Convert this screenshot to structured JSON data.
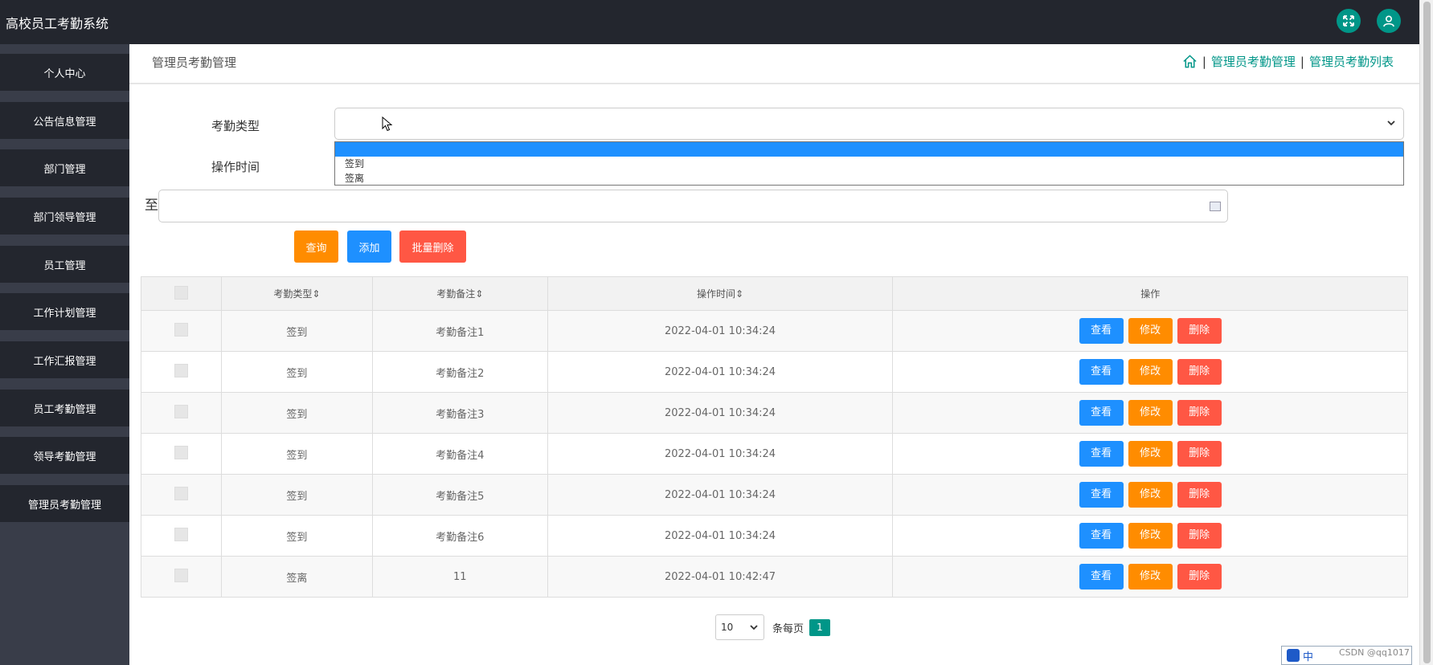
{
  "app": {
    "title": "高校员工考勤系统"
  },
  "sidebar": {
    "items": [
      {
        "label": "个人中心"
      },
      {
        "label": "公告信息管理"
      },
      {
        "label": "部门管理"
      },
      {
        "label": "部门领导管理"
      },
      {
        "label": "员工管理"
      },
      {
        "label": "工作计划管理"
      },
      {
        "label": "工作汇报管理"
      },
      {
        "label": "员工考勤管理"
      },
      {
        "label": "领导考勤管理"
      },
      {
        "label": "管理员考勤管理"
      }
    ]
  },
  "breadcrumb": {
    "page_title": "管理员考勤管理",
    "sep": "|",
    "path1": "管理员考勤管理",
    "path2": "管理员考勤列表"
  },
  "search": {
    "type_label": "考勤类型",
    "time_label": "操作时间",
    "to_label": "至",
    "type_value": "",
    "dropdown_options": [
      "",
      "签到",
      "签离"
    ]
  },
  "buttons": {
    "query": "查询",
    "add": "添加",
    "batch_delete": "批量删除"
  },
  "table": {
    "headers": [
      "考勤类型",
      "考勤备注",
      "操作时间",
      "操作"
    ],
    "sort_glyph": "⇕",
    "rows": [
      {
        "type": "签到",
        "note": "考勤备注1",
        "time": "2022-04-01 10:34:24"
      },
      {
        "type": "签到",
        "note": "考勤备注2",
        "time": "2022-04-01 10:34:24"
      },
      {
        "type": "签到",
        "note": "考勤备注3",
        "time": "2022-04-01 10:34:24"
      },
      {
        "type": "签到",
        "note": "考勤备注4",
        "time": "2022-04-01 10:34:24"
      },
      {
        "type": "签到",
        "note": "考勤备注5",
        "time": "2022-04-01 10:34:24"
      },
      {
        "type": "签到",
        "note": "考勤备注6",
        "time": "2022-04-01 10:34:24"
      },
      {
        "type": "签离",
        "note": "11",
        "time": "2022-04-01 10:42:47"
      }
    ],
    "actions": {
      "view": "查看",
      "edit": "修改",
      "delete": "删除"
    }
  },
  "pager": {
    "page_size": "10",
    "per_page_label": "条每页",
    "current_page": "1"
  },
  "ime": {
    "mode": "中"
  },
  "watermark": "CSDN @qq1017",
  "colors": {
    "topbar": "#23262e",
    "teal": "#009688",
    "blue": "#1e90ff",
    "orange": "#ff8c00",
    "red": "#ff5744"
  }
}
